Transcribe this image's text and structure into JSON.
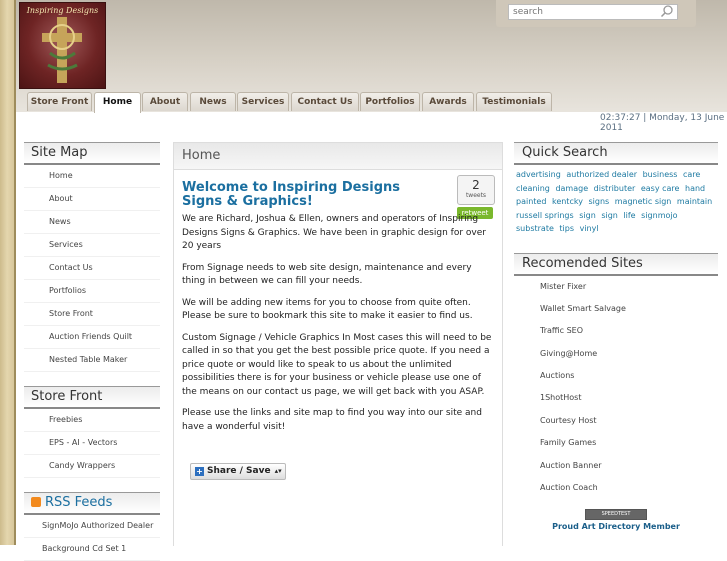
{
  "header": {
    "logo_text": "Inspiring Designs",
    "search_placeholder": "search",
    "datetime": "02:37:27 | Monday, 13 June 2011"
  },
  "nav": {
    "tabs": [
      {
        "label": "Store Front"
      },
      {
        "label": "Home"
      },
      {
        "label": "About"
      },
      {
        "label": "News"
      },
      {
        "label": "Services"
      },
      {
        "label": "Contact Us"
      },
      {
        "label": "Portfolios"
      },
      {
        "label": "Awards"
      },
      {
        "label": "Testimonials"
      }
    ],
    "active": "Home"
  },
  "sidebar_left": {
    "site_map": {
      "title": "Site Map",
      "items": [
        "Home",
        "About",
        "News",
        "Services",
        "Contact Us",
        "Portfolios",
        "Store Front",
        "Auction Friends Quilt",
        "Nested Table Maker"
      ]
    },
    "store_front": {
      "title": "Store Front",
      "items": [
        "Freebies",
        "EPS - AI - Vectors",
        "Candy Wrappers"
      ]
    },
    "rss": {
      "title": "RSS Feeds",
      "items": [
        "SignMoJo Authorized Dealer",
        "Background Cd Set 1"
      ]
    }
  },
  "main": {
    "heading": "Home",
    "post_title": "Welcome to Inspiring Designs Signs & Graphics!",
    "tweet_count": "2",
    "tweet_label": "tweets",
    "retweet_label": "retweet",
    "paragraphs": [
      "We are Richard, Joshua & Ellen, owners and operators of Inspiring Designs Signs & Graphics. We have been in graphic design for over 20 years",
      "From Signage needs to web site design, maintenance and every thing in between we can fill your needs.",
      "We will be adding new items for you to choose from quite often. Please be sure to bookmark this site to make it easier to find us.",
      "Custom Signage / Vehicle Graphics In Most cases this will need to be called in so that you get the best possible price quote. If you need a price quote or would like to speak to us about the unlimited possibilities there is for your business or vehicle please use one of the  means on our contact us page, we will get back with you ASAP.",
      "Please use the links and site map to find you way into our site and have a wonderful visit!"
    ],
    "share_label": "Share / Save"
  },
  "sidebar_right": {
    "quick_search": {
      "title": "Quick Search",
      "tags": [
        "advertising",
        "authorized dealer",
        "business",
        "care",
        "cleaning",
        "damage",
        "distributer",
        "easy care",
        "hand painted",
        "kentcky",
        "signs",
        "magnetic sign",
        "maintain",
        "russell springs",
        "sign",
        "sign",
        "life",
        "signmojo",
        "substrate",
        "tips",
        "vinyl"
      ]
    },
    "recommended": {
      "title": "Recomended Sites",
      "items": [
        "Mister Fixer",
        "Wallet Smart Salvage",
        "Traffic SEO",
        "Giving@Home",
        "Auctions",
        "1ShotHost",
        "Courtesy Host",
        "Family Games",
        "Auction Banner",
        "Auction Coach"
      ]
    },
    "badge_text": "SPEEDTEST",
    "proud_member": "Proud Art Directory Member"
  },
  "colors": {
    "accent_blue": "#1b6fa0",
    "tag_blue": "#1e7aa2",
    "retweet_green": "#7ab82c",
    "logo_maroon": "#6e2424"
  },
  "icons": {
    "search": "search-icon",
    "rss": "rss-icon",
    "share": "share-plus-icon"
  }
}
